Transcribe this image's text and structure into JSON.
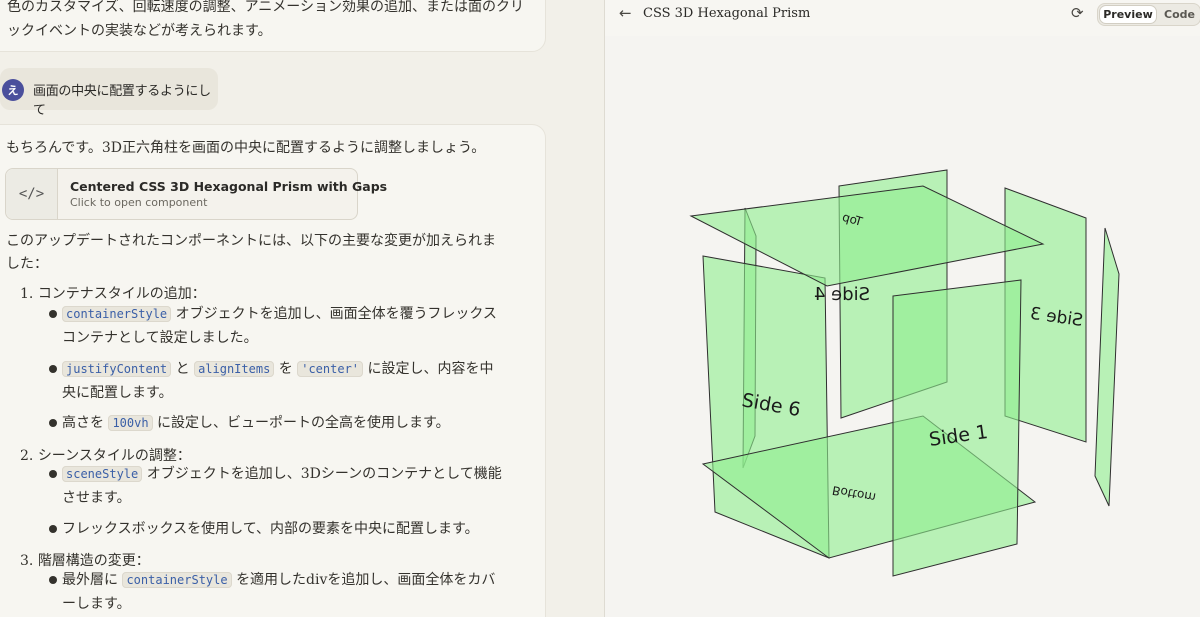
{
  "chat": {
    "prev_text": "色のカスタマイズ、回転速度の調整、アニメーション効果の追加、または面のクリックイベントの実装などが考えられます。",
    "user_initial": "え",
    "user_message": "画面の中央に配置するようにして",
    "intro": "もちろんです。3D正六角柱を画面の中央に配置するように調整しましょう。",
    "artifact": {
      "icon": "</>",
      "title": "Centered CSS 3D Hexagonal Prism with Gaps",
      "subtitle": "Click to open component"
    },
    "summary": "このアップデートされたコンポーネントには、以下の主要な変更が加えられました：",
    "list": [
      {
        "num": "1.",
        "heading": "コンテナスタイルの追加：",
        "bullets": [
          {
            "code1": "containerStyle",
            "text1": "オブジェクトを追加し、画面全体を覆うフレックスコンテナとして設定しました。"
          },
          {
            "code1": "justifyContent",
            "mid1": "と",
            "code2": "alignItems",
            "mid2": "を",
            "code3": "'center'",
            "text1": "に設定し、内容を中央に配置します。"
          },
          {
            "pre": "高さを",
            "code1": "100vh",
            "text1": "に設定し、ビューポートの全高を使用します。"
          }
        ]
      },
      {
        "num": "2.",
        "heading": "シーンスタイルの調整：",
        "bullets": [
          {
            "code1": "sceneStyle",
            "text1": "オブジェクトを追加し、3Dシーンのコンテナとして機能させます。"
          },
          {
            "text1": "フレックスボックスを使用して、内部の要素を中央に配置します。"
          }
        ]
      },
      {
        "num": "3.",
        "heading": "階層構造の変更：",
        "bullets": [
          {
            "pre": "最外層に",
            "code1": "containerStyle",
            "text1": "を適用したdivを追加し、画面全体をカバーします。"
          }
        ]
      }
    ]
  },
  "preview": {
    "back_icon": "←",
    "title": "CSS 3D Hexagonal Prism",
    "refresh_icon": "⟳",
    "tab_preview": "Preview",
    "tab_code": "Code",
    "face_color": "#90ee90",
    "faces": {
      "top": "Top",
      "bottom": "Bottom",
      "side1": "Side 1",
      "side3": "Side 3",
      "side4": "Side 4",
      "side6": "Side 6"
    }
  }
}
